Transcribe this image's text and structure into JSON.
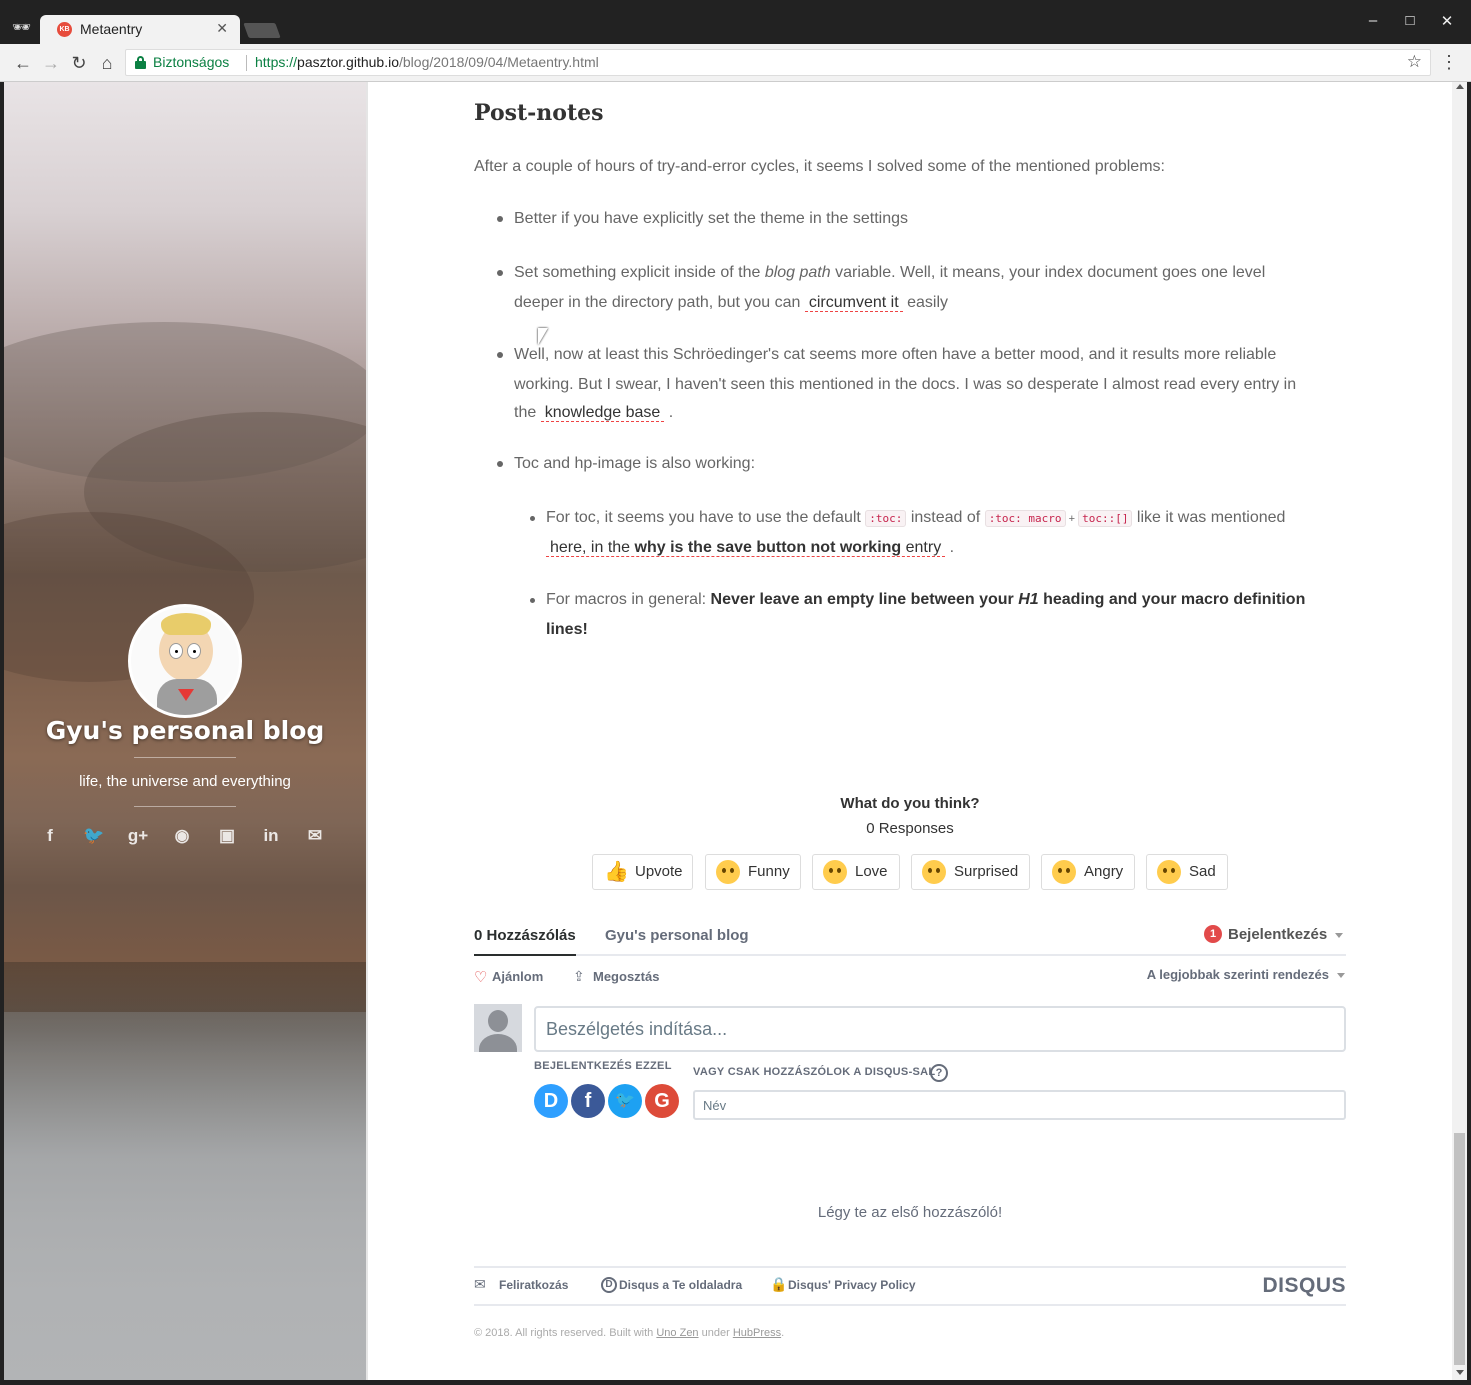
{
  "browser": {
    "tab_title": "Metaentry",
    "tab_favicon_text": "KB",
    "secure_label": "Biztonságos",
    "url_scheme": "https://",
    "url_host": "pasztor.github.io",
    "url_path": "/blog/2018/09/04/Metaentry.html"
  },
  "sidebar": {
    "blog_title": "Gyu's personal blog",
    "tagline": "life, the universe and everything",
    "social_icons": [
      "facebook-icon",
      "twitter-icon",
      "google-plus-icon",
      "github-icon",
      "instagram-icon",
      "linkedin-icon",
      "email-icon"
    ]
  },
  "article": {
    "heading": "Post-notes",
    "intro": "After a couple of hours of try-and-error cycles, it seems I solved some of the mentioned problems:",
    "b1": "Better if you have explicitly set the theme in the settings",
    "b2_pre": "Set something explicit inside of the ",
    "b2_em": "blog path",
    "b2_mid": " variable. Well, it means, your index document goes one level",
    "b2_l2": "deeper in the directory path, but you can ",
    "b2_link": "circumvent it",
    "b2_post": " easily",
    "b3_l1": "Well, now at least this Schröedinger's cat seems more often have a better mood, and it results more reliable",
    "b3_l2": "working. But I swear, I haven't seen this mentioned in the docs. I was so desperate I almost read every entry in",
    "b3_l3_pre": "the ",
    "b3_link": "knowledge base",
    "b3_l3_post": " .",
    "b4": "Toc and hp-image is also working:",
    "s1_pre": "For toc, it seems you have to use the default ",
    "s1_code1": ":toc:",
    "s1_mid": " instead of ",
    "s1_code2": ":toc: macro",
    "s1_plus": " + ",
    "s1_code3": "toc::[]",
    "s1_post": " like it was mentioned",
    "s1_link_pre": "here, in the ",
    "s1_link_strong": "why is the save button not working",
    "s1_link_post": " entry",
    "s1_end": " .",
    "s2_pre": "For macros in general: ",
    "s2_strong_a": "Never leave an empty line between your ",
    "s2_strong_em": "H1",
    "s2_strong_b": " heading and your macro definition",
    "s2_strong_c": "lines!"
  },
  "reactions": {
    "question": "What do you think?",
    "count": "0 Responses",
    "buttons": [
      "Upvote",
      "Funny",
      "Love",
      "Surprised",
      "Angry",
      "Sad"
    ]
  },
  "disqus": {
    "tab_comments": "0 Hozzászólás",
    "tab_blog": "Gyu's personal blog",
    "notification_count": "1",
    "login": "Bejelentkezés",
    "recommend": "Ajánlom",
    "share": "Megosztás",
    "sort": "A legjobbak szerinti rendezés",
    "placeholder": "Beszélgetés indítása...",
    "login_with": "BEJELENTKEZÉS EZZEL",
    "or_disqus": "VAGY CSAK HOZZÁSZÓLOK A DISQUS-SAL",
    "name_placeholder": "Név",
    "first": "Légy te az első hozzászóló!",
    "footer_subscribe": "Feliratkozás",
    "footer_add": "Disqus a Te oldaladra",
    "footer_privacy": "Disqus' Privacy Policy",
    "logo": "DISQUS",
    "colors": {
      "disqus_blue": "#2e9fff",
      "facebook": "#3b5998",
      "twitter": "#1da1f2",
      "google": "#dd4b39"
    }
  },
  "footer": {
    "copy_pre": "© 2018. All rights reserved. Built with ",
    "theme": "Uno Zen",
    "under": " under ",
    "platform": "HubPress",
    "end": "."
  }
}
